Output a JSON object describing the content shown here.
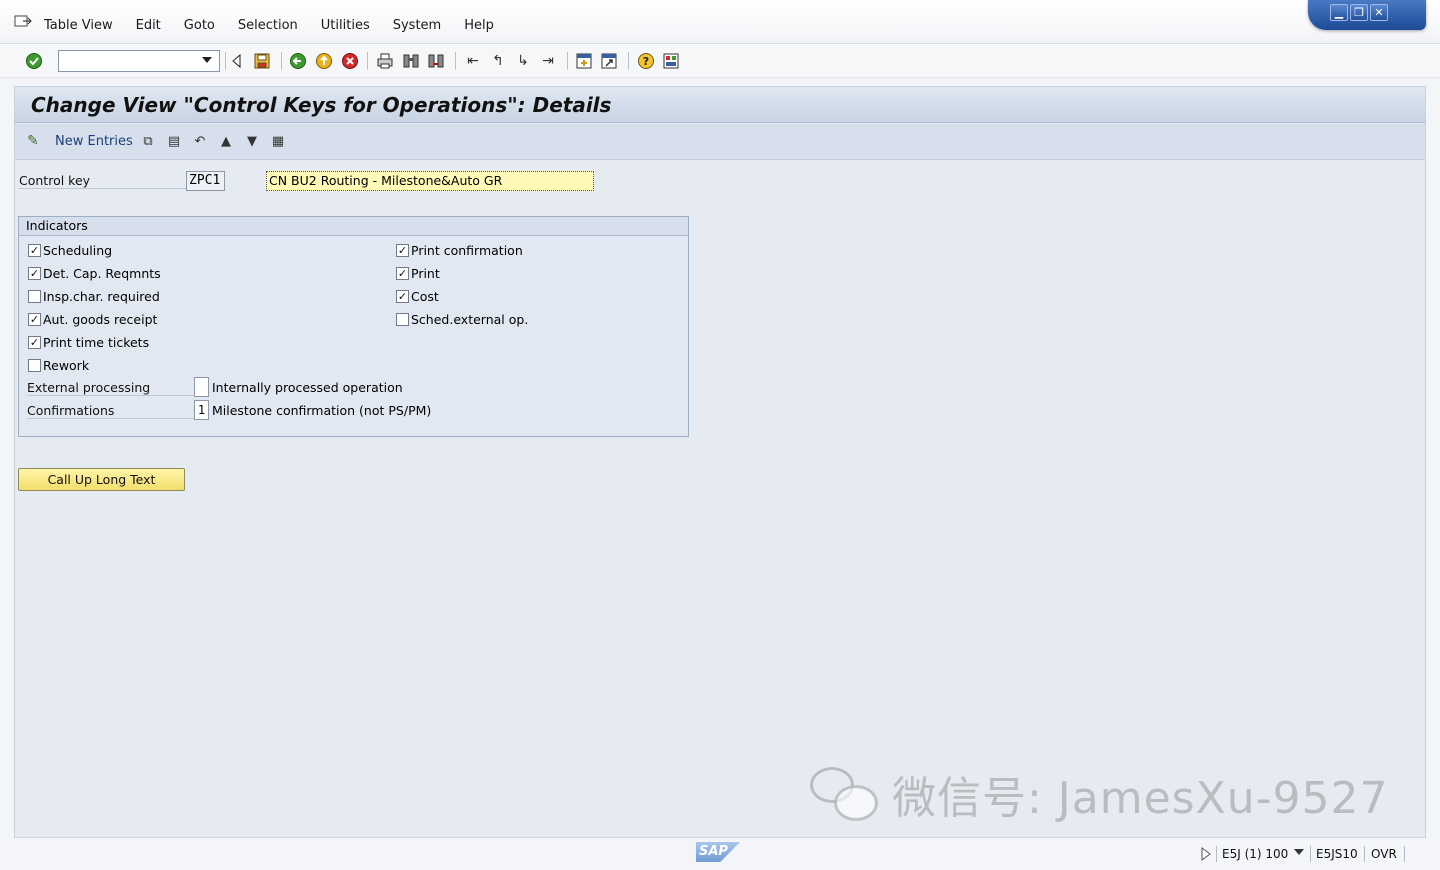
{
  "menu": {
    "items": [
      {
        "label": "Table View"
      },
      {
        "label": "Edit"
      },
      {
        "label": "Goto"
      },
      {
        "label": "Selection"
      },
      {
        "label": "Utilities"
      },
      {
        "label": "System"
      },
      {
        "label": "Help"
      }
    ]
  },
  "toolbar": {
    "command_value": "",
    "icons": [
      "enter-icon",
      "back-icon",
      "save-icon",
      "exit-icon",
      "cancel-icon",
      "print-icon",
      "find-icon",
      "find-next-icon",
      "first-page-icon",
      "previous-page-icon",
      "next-page-icon",
      "last-page-icon",
      "create-session-icon",
      "shortcut-icon",
      "help-icon",
      "layout-icon"
    ]
  },
  "title": "Change View \"Control Keys for Operations\": Details",
  "app_toolbar": {
    "new_entries": "New Entries"
  },
  "control_key": {
    "label": "Control key",
    "value": "ZPC1",
    "description": "CN BU2 Routing - Milestone&Auto GR"
  },
  "indicators": {
    "title": "Indicators",
    "left": [
      {
        "label": "Scheduling",
        "checked": true
      },
      {
        "label": "Det. Cap. Reqmnts",
        "checked": true
      },
      {
        "label": "Insp.char. required",
        "checked": false
      },
      {
        "label": "Aut. goods receipt",
        "checked": true
      },
      {
        "label": "Print time tickets",
        "checked": true
      },
      {
        "label": "Rework",
        "checked": false
      }
    ],
    "right": [
      {
        "label": "Print confirmation",
        "checked": true
      },
      {
        "label": "Print",
        "checked": true
      },
      {
        "label": "Cost",
        "checked": true
      },
      {
        "label": "Sched.external op.",
        "checked": false
      }
    ],
    "external_processing": {
      "label": "External processing",
      "value": "",
      "text": "Internally processed operation"
    },
    "confirmations": {
      "label": "Confirmations",
      "value": "1",
      "text": "Milestone confirmation (not PS/PM)"
    }
  },
  "long_text_button": "Call Up Long Text",
  "status": {
    "logo": "SAP",
    "system": "E5J (1) 100",
    "server": "E5JS10",
    "mode": "OVR"
  },
  "watermark": "微信号: JamesXu-9527",
  "colors": {
    "accent_button": "#f2de6c",
    "description_field": "#fff9b8",
    "window_controls": "#1d4a96"
  }
}
